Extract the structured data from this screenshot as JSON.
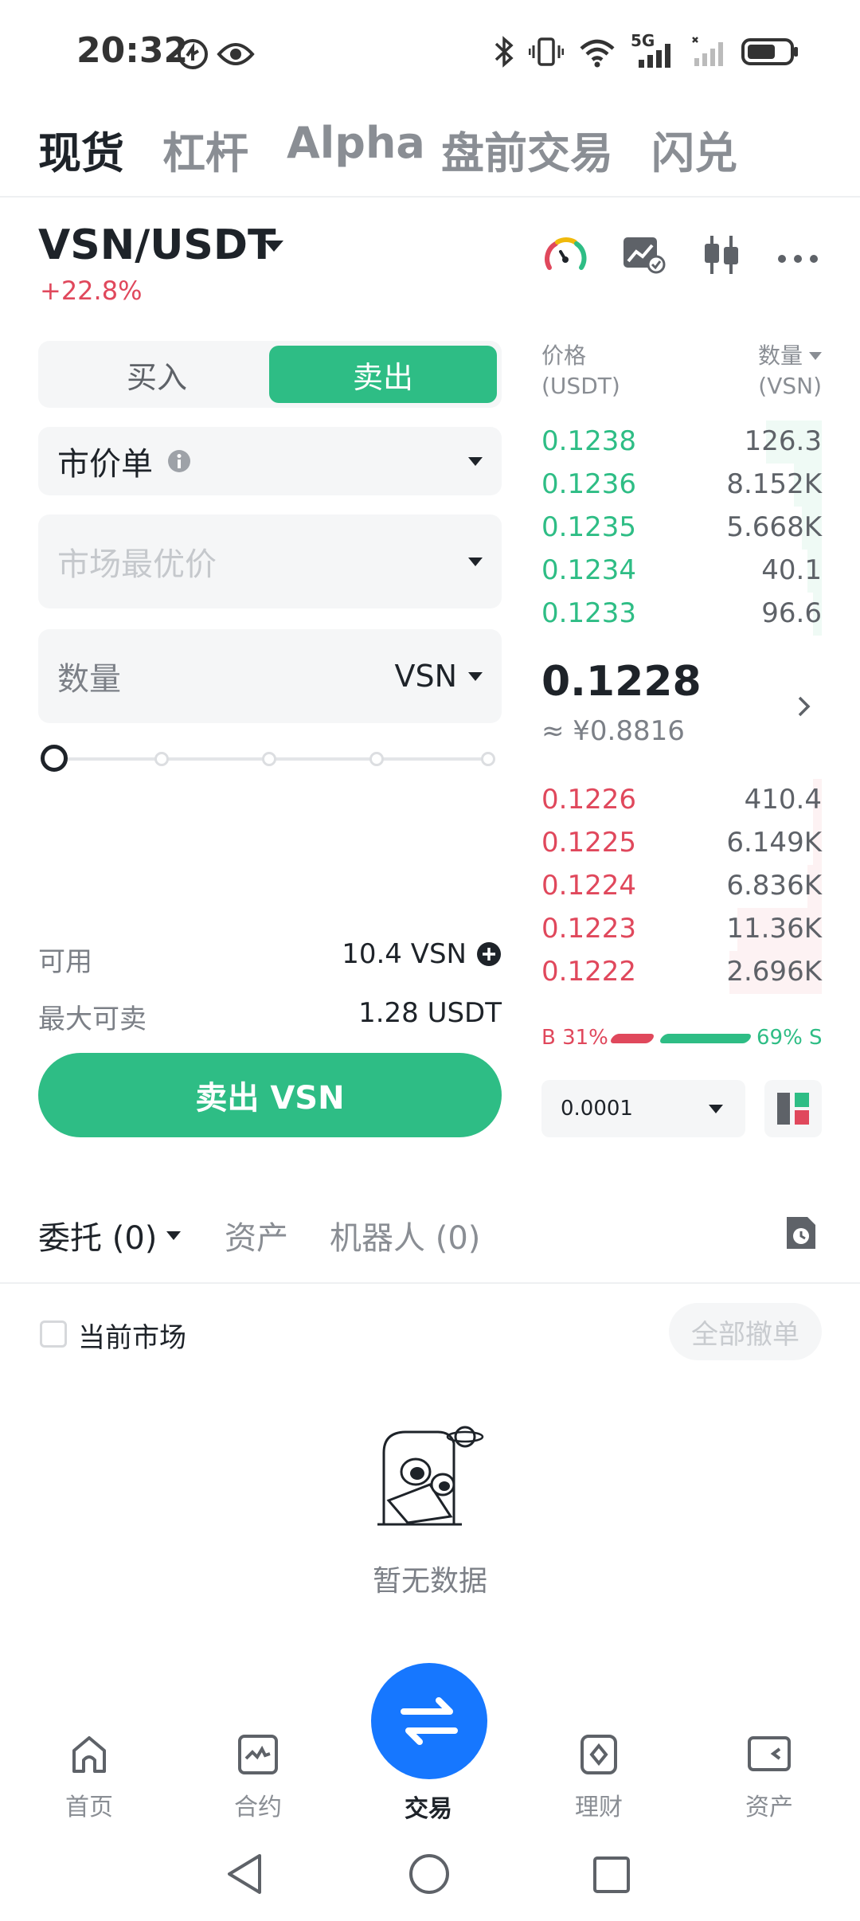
{
  "status_bar": {
    "time": "20:32",
    "network": "5G"
  },
  "top_tabs": [
    {
      "label": "现货",
      "active": true
    },
    {
      "label": "杠杆",
      "active": false
    },
    {
      "label": "Alpha",
      "active": false
    },
    {
      "label": "盘前交易",
      "active": false
    },
    {
      "label": "闪兑",
      "active": false
    }
  ],
  "pair": {
    "symbol": "VSN/USDT",
    "change": "+22.8%"
  },
  "order_form": {
    "buy_label": "买入",
    "sell_label": "卖出",
    "order_type": "市价单",
    "price_placeholder": "市场最优价",
    "amount_label": "数量",
    "amount_unit": "VSN",
    "slider_percent": 0,
    "available_label": "可用",
    "available_value": "10.4 VSN",
    "max_sell_label": "最大可卖",
    "max_sell_value": "1.28 USDT",
    "submit_label": "卖出 VSN"
  },
  "order_book": {
    "price_header": "价格",
    "price_unit": "(USDT)",
    "qty_header": "数量",
    "qty_unit": "(VSN)",
    "asks": [
      {
        "price": "0.1238",
        "qty": "126.3",
        "depth": 0.2
      },
      {
        "price": "0.1236",
        "qty": "8.152K",
        "depth": 0.1
      },
      {
        "price": "0.1235",
        "qty": "5.668K",
        "depth": 0.07
      },
      {
        "price": "0.1234",
        "qty": "40.1",
        "depth": 0.05
      },
      {
        "price": "0.1233",
        "qty": "96.6",
        "depth": 0.03
      }
    ],
    "last_price": "0.1228",
    "last_price_cny": "≈ ¥0.8816",
    "bids": [
      {
        "price": "0.1226",
        "qty": "410.4",
        "depth": 0.03
      },
      {
        "price": "0.1225",
        "qty": "6.149K",
        "depth": 0.03
      },
      {
        "price": "0.1224",
        "qty": "6.836K",
        "depth": 0.05
      },
      {
        "price": "0.1223",
        "qty": "11.36K",
        "depth": 0.3
      },
      {
        "price": "0.1222",
        "qty": "2.696K",
        "depth": 0.33
      }
    ],
    "buy_ratio": "B 31%",
    "sell_ratio": "69% S",
    "precision": "0.0001"
  },
  "orders": {
    "tabs": [
      {
        "label": "委托 (0)",
        "active": true
      },
      {
        "label": "资产",
        "active": false
      },
      {
        "label": "机器人 (0)",
        "active": false
      }
    ],
    "current_market_label": "当前市场",
    "cancel_all_label": "全部撤单",
    "empty_text": "暂无数据"
  },
  "bottom_nav": [
    {
      "label": "首页",
      "icon": "home-icon"
    },
    {
      "label": "合约",
      "icon": "futures-icon"
    },
    {
      "label": "交易",
      "icon": "trade-swap-icon",
      "active": true
    },
    {
      "label": "理财",
      "icon": "earn-icon"
    },
    {
      "label": "资产",
      "icon": "wallet-icon"
    }
  ],
  "colors": {
    "green": "#2ebd85",
    "red": "#e0485c",
    "blue": "#1677ff"
  }
}
